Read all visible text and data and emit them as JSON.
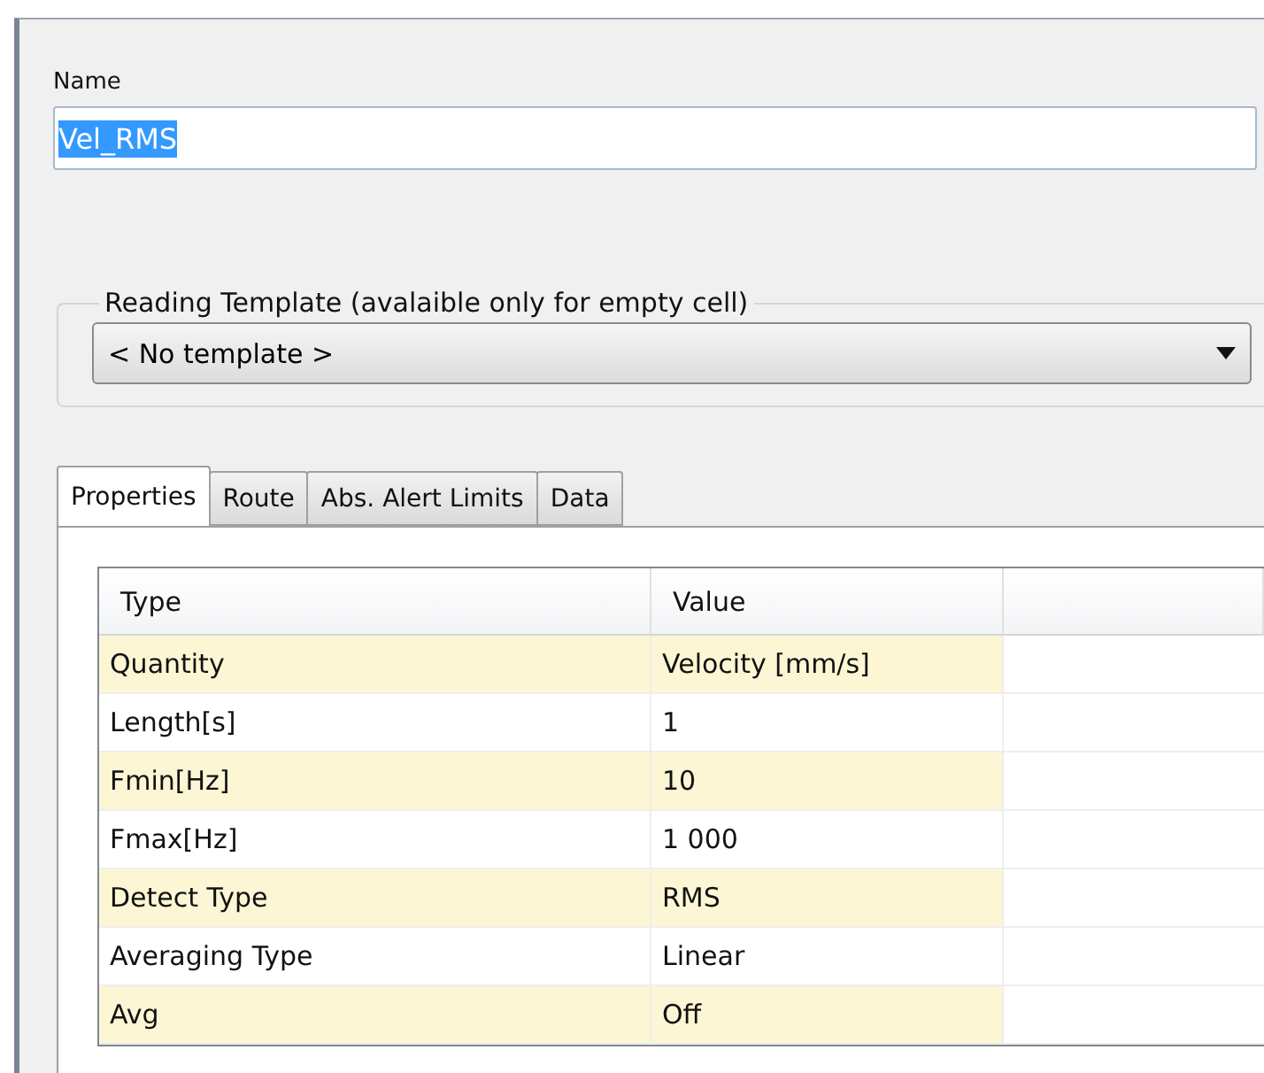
{
  "name_field": {
    "label": "Name",
    "value": "Vel_RMS",
    "selected": true
  },
  "reading_template": {
    "legend": "Reading Template (avalaible only for empty cell)",
    "value": "< No template >"
  },
  "tabs": [
    {
      "label": "Properties",
      "selected": true
    },
    {
      "label": "Route",
      "selected": false
    },
    {
      "label": "Abs. Alert Limits",
      "selected": false
    },
    {
      "label": "Data",
      "selected": false
    }
  ],
  "table": {
    "columns": [
      "Type",
      "Value"
    ],
    "rows": [
      {
        "type": "Quantity",
        "value": "Velocity [mm/s]",
        "shaded": true
      },
      {
        "type": "Length[s]",
        "value": "1",
        "shaded": false
      },
      {
        "type": "Fmin[Hz]",
        "value": "10",
        "shaded": true
      },
      {
        "type": "Fmax[Hz]",
        "value": "1 000",
        "shaded": false
      },
      {
        "type": "Detect Type",
        "value": "RMS",
        "shaded": true
      },
      {
        "type": "Averaging Type",
        "value": "Linear",
        "shaded": false
      },
      {
        "type": "Avg",
        "value": "Off",
        "shaded": true
      }
    ]
  }
}
